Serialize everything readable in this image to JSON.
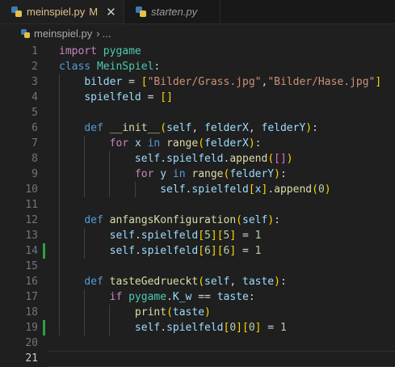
{
  "tabs": [
    {
      "label": "meinspiel.py",
      "status": "M",
      "close": "✕"
    },
    {
      "label": "starten.py"
    }
  ],
  "breadcrumb": {
    "file": "meinspiel.py",
    "separator": "›",
    "more": "..."
  },
  "gutter_modified_lines": [
    14,
    19
  ],
  "current_line": 21,
  "lines": [
    [
      [
        "k",
        "import"
      ],
      [
        "p",
        " "
      ],
      [
        "c",
        "pygame"
      ]
    ],
    [
      [
        "kb",
        "class"
      ],
      [
        "p",
        " "
      ],
      [
        "c",
        "MeinSpiel"
      ],
      [
        "p",
        ":"
      ]
    ],
    [
      [
        "p",
        "    "
      ],
      [
        "v",
        "bilder"
      ],
      [
        "p",
        " = "
      ],
      [
        "b1",
        "["
      ],
      [
        "s",
        "\"Bilder/Grass.jpg\""
      ],
      [
        "p",
        ","
      ],
      [
        "s",
        "\"Bilder/Hase.jpg\""
      ],
      [
        "b1",
        "]"
      ]
    ],
    [
      [
        "p",
        "    "
      ],
      [
        "v",
        "spielfeld"
      ],
      [
        "p",
        " = "
      ],
      [
        "b1",
        "[]"
      ]
    ],
    [],
    [
      [
        "p",
        "    "
      ],
      [
        "kb",
        "def"
      ],
      [
        "p",
        " "
      ],
      [
        "f",
        "__init__"
      ],
      [
        "b1",
        "("
      ],
      [
        "v",
        "self"
      ],
      [
        "p",
        ", "
      ],
      [
        "v",
        "felderX"
      ],
      [
        "p",
        ", "
      ],
      [
        "v",
        "felderY"
      ],
      [
        "b1",
        ")"
      ],
      [
        "p",
        ":"
      ]
    ],
    [
      [
        "p",
        "        "
      ],
      [
        "k",
        "for"
      ],
      [
        "p",
        " "
      ],
      [
        "v",
        "x"
      ],
      [
        "p",
        " "
      ],
      [
        "kb",
        "in"
      ],
      [
        "p",
        " "
      ],
      [
        "f",
        "range"
      ],
      [
        "b1",
        "("
      ],
      [
        "v",
        "felderX"
      ],
      [
        "b1",
        ")"
      ],
      [
        "p",
        ":"
      ]
    ],
    [
      [
        "p",
        "            "
      ],
      [
        "v",
        "self"
      ],
      [
        "p",
        "."
      ],
      [
        "v",
        "spielfeld"
      ],
      [
        "p",
        "."
      ],
      [
        "f",
        "append"
      ],
      [
        "b1",
        "("
      ],
      [
        "b2",
        "[]"
      ],
      [
        "b1",
        ")"
      ]
    ],
    [
      [
        "p",
        "            "
      ],
      [
        "k",
        "for"
      ],
      [
        "p",
        " "
      ],
      [
        "v",
        "y"
      ],
      [
        "p",
        " "
      ],
      [
        "kb",
        "in"
      ],
      [
        "p",
        " "
      ],
      [
        "f",
        "range"
      ],
      [
        "b1",
        "("
      ],
      [
        "v",
        "felderY"
      ],
      [
        "b1",
        ")"
      ],
      [
        "p",
        ":"
      ]
    ],
    [
      [
        "p",
        "                "
      ],
      [
        "v",
        "self"
      ],
      [
        "p",
        "."
      ],
      [
        "v",
        "spielfeld"
      ],
      [
        "b1",
        "["
      ],
      [
        "v",
        "x"
      ],
      [
        "b1",
        "]"
      ],
      [
        "p",
        "."
      ],
      [
        "f",
        "append"
      ],
      [
        "b1",
        "("
      ],
      [
        "n",
        "0"
      ],
      [
        "b1",
        ")"
      ]
    ],
    [],
    [
      [
        "p",
        "    "
      ],
      [
        "kb",
        "def"
      ],
      [
        "p",
        " "
      ],
      [
        "f",
        "anfangsKonfiguration"
      ],
      [
        "b1",
        "("
      ],
      [
        "v",
        "self"
      ],
      [
        "b1",
        ")"
      ],
      [
        "p",
        ":"
      ]
    ],
    [
      [
        "p",
        "        "
      ],
      [
        "v",
        "self"
      ],
      [
        "p",
        "."
      ],
      [
        "v",
        "spielfeld"
      ],
      [
        "b1",
        "["
      ],
      [
        "n",
        "5"
      ],
      [
        "b1",
        "]"
      ],
      [
        "b1",
        "["
      ],
      [
        "n",
        "5"
      ],
      [
        "b1",
        "]"
      ],
      [
        "p",
        " = "
      ],
      [
        "n",
        "1"
      ]
    ],
    [
      [
        "p",
        "        "
      ],
      [
        "v",
        "self"
      ],
      [
        "p",
        "."
      ],
      [
        "v",
        "spielfeld"
      ],
      [
        "b1",
        "["
      ],
      [
        "n",
        "6"
      ],
      [
        "b1",
        "]"
      ],
      [
        "b1",
        "["
      ],
      [
        "n",
        "6"
      ],
      [
        "b1",
        "]"
      ],
      [
        "p",
        " = "
      ],
      [
        "n",
        "1"
      ]
    ],
    [],
    [
      [
        "p",
        "    "
      ],
      [
        "kb",
        "def"
      ],
      [
        "p",
        " "
      ],
      [
        "f",
        "tasteGedrueckt"
      ],
      [
        "b1",
        "("
      ],
      [
        "v",
        "self"
      ],
      [
        "p",
        ", "
      ],
      [
        "v",
        "taste"
      ],
      [
        "b1",
        ")"
      ],
      [
        "p",
        ":"
      ]
    ],
    [
      [
        "p",
        "        "
      ],
      [
        "k",
        "if"
      ],
      [
        "p",
        " "
      ],
      [
        "c",
        "pygame"
      ],
      [
        "p",
        "."
      ],
      [
        "v",
        "K_w"
      ],
      [
        "p",
        " == "
      ],
      [
        "v",
        "taste"
      ],
      [
        "p",
        ":"
      ]
    ],
    [
      [
        "p",
        "            "
      ],
      [
        "f",
        "print"
      ],
      [
        "b1",
        "("
      ],
      [
        "v",
        "taste"
      ],
      [
        "b1",
        ")"
      ]
    ],
    [
      [
        "p",
        "            "
      ],
      [
        "v",
        "self"
      ],
      [
        "p",
        "."
      ],
      [
        "v",
        "spielfeld"
      ],
      [
        "b1",
        "["
      ],
      [
        "n",
        "0"
      ],
      [
        "b1",
        "]"
      ],
      [
        "b1",
        "["
      ],
      [
        "n",
        "0"
      ],
      [
        "b1",
        "]"
      ],
      [
        "p",
        " = "
      ],
      [
        "n",
        "1"
      ]
    ],
    [],
    []
  ]
}
